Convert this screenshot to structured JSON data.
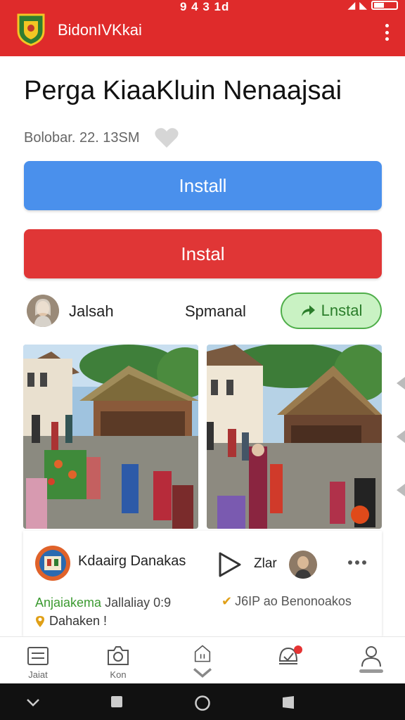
{
  "status_bar": {
    "time": "9 4 3 1d"
  },
  "app_bar": {
    "title": "BidonIVKkai",
    "logo_icon": "emblem-icon",
    "menu_icon": "more-vert-icon",
    "color": "#df2b2b"
  },
  "app": {
    "title": "Perga KiaaKluin Nenaajsai",
    "meta": "Bolobar. 22. 13SM",
    "favorite_icon": "heart-icon"
  },
  "buttons": {
    "install_primary": "Install",
    "install_secondary": "Instal",
    "green_install": "Lnstal",
    "colors": {
      "blue": "#4a90ec",
      "red": "#e03636",
      "green": "#c9f2c3"
    }
  },
  "developer": {
    "name": "Jalsah",
    "label": "Spmanal"
  },
  "screenshots": [
    "market-scene-photo-1",
    "market-scene-photo-2"
  ],
  "card": {
    "name": "Kdaairg Danakas",
    "play_label": "Zlar",
    "line1_green": "Anjaiakema",
    "line1_gray": "Jallaliay  0:9",
    "check_text": "J6IP ao Benonoakos",
    "line2": "Dahaken !"
  },
  "bottom_nav": [
    {
      "label": "Jaiat",
      "icon": "list-icon"
    },
    {
      "label": "Kon",
      "icon": "camera-icon"
    },
    {
      "label": "",
      "icon": "home-icon"
    },
    {
      "label": "",
      "icon": "notification-icon"
    },
    {
      "label": "",
      "icon": "profile-icon"
    }
  ],
  "system_nav": [
    "back-icon",
    "recents-icon",
    "home-circle-icon",
    "app-switch-icon"
  ]
}
